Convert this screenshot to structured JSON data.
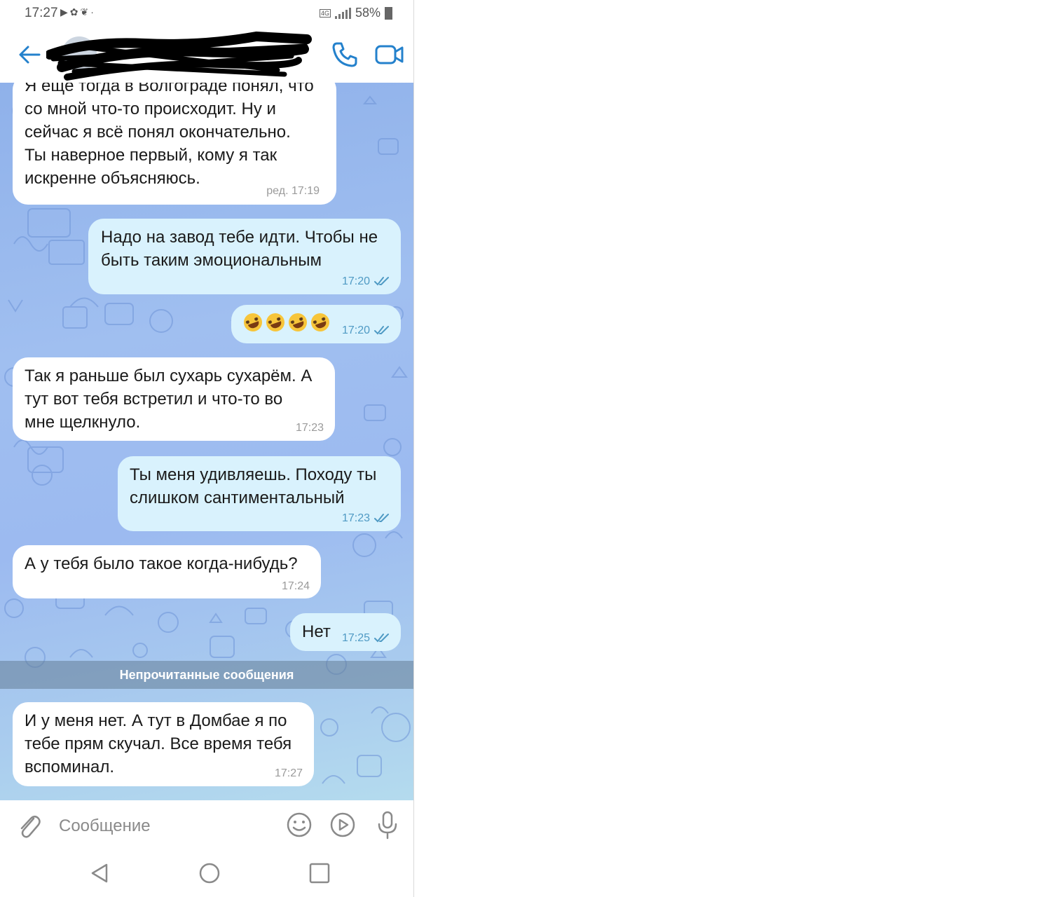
{
  "status_bar": {
    "time": "17:27",
    "notification_icons": [
      "youtube-icon",
      "app-icon",
      "butterfly-icon",
      "more-icon"
    ],
    "network": "4G",
    "battery": "58%"
  },
  "header": {
    "contact_name": "",
    "contact_status": ""
  },
  "messages": [
    {
      "direction": "in",
      "text": "Я ещё тогда в Волгограде понял, что\nсо мной что-то происходит. Ну и\nсейчас я всё понял окончательно.\nТы наверное первый, кому я так\nискренне объясняюсь.",
      "time": "ред. 17:19"
    },
    {
      "direction": "out",
      "text": "Надо на завод тебе идти. Чтобы не\nбыть таким эмоциональным",
      "time": "17:20",
      "read": true
    },
    {
      "direction": "out",
      "text": "",
      "emoji": [
        "rofl-emoji",
        "rofl-emoji",
        "rofl-emoji",
        "rofl-emoji"
      ],
      "time": "17:20",
      "read": true
    },
    {
      "direction": "in",
      "text": "Так я раньше был сухарь сухарём. А\nтут вот тебя встретил и что-то во\nмне щелкнуло.",
      "time": "17:23"
    },
    {
      "direction": "out",
      "text": "Ты меня удивляешь. Походу ты\nслишком сантиментальный",
      "time": "17:23",
      "read": true
    },
    {
      "direction": "in",
      "text": "А у тебя было такое когда-нибудь?",
      "time": "17:24"
    },
    {
      "direction": "out",
      "text": "Нет",
      "time": "17:25",
      "read": true
    },
    {
      "direction": "in",
      "text": "И у меня нет. А тут в Домбае я по\nтебе прям скучал. Все время тебя\nвспоминал.",
      "time": "17:27"
    }
  ],
  "unread_divider": "Непрочитанные сообщения",
  "input": {
    "placeholder": "Сообщение"
  },
  "colors": {
    "accent": "#2481cc",
    "incoming_bubble": "#ffffff",
    "outgoing_bubble": "#d9f2fd",
    "outgoing_time": "#4f9ac4",
    "background_top": "#8fb1ea",
    "background_bottom": "#b4dbee"
  }
}
